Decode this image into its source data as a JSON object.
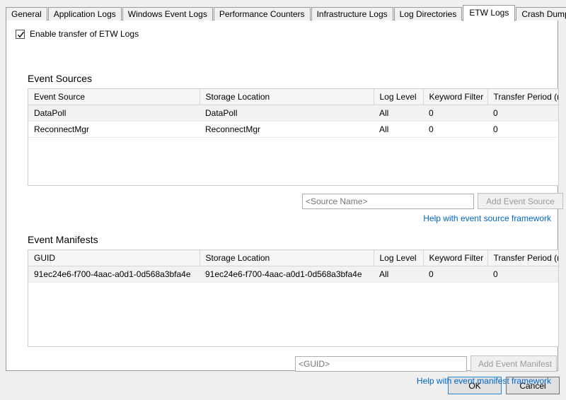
{
  "tabs": [
    {
      "label": "General",
      "selected": false
    },
    {
      "label": "Application Logs",
      "selected": false
    },
    {
      "label": "Windows Event Logs",
      "selected": false
    },
    {
      "label": "Performance Counters",
      "selected": false
    },
    {
      "label": "Infrastructure Logs",
      "selected": false
    },
    {
      "label": "Log Directories",
      "selected": false
    },
    {
      "label": "ETW Logs",
      "selected": true
    },
    {
      "label": "Crash Dumps",
      "selected": false
    }
  ],
  "enable_checkbox": {
    "label": "Enable transfer of ETW Logs",
    "checked": true,
    "icon": "checkmark-icon"
  },
  "event_sources": {
    "title": "Event Sources",
    "columns": [
      "Event Source",
      "Storage Location",
      "Log Level",
      "Keyword Filter",
      "Transfer Period (min)"
    ],
    "rows": [
      {
        "name": "DataPoll",
        "location": "DataPoll",
        "level": "All",
        "keyword": "0",
        "period": "0"
      },
      {
        "name": "ReconnectMgr",
        "location": "ReconnectMgr",
        "level": "All",
        "keyword": "0",
        "period": "0"
      }
    ],
    "input_placeholder": "<Source Name>",
    "input_value": "",
    "add_button": "Add Event Source",
    "help_link": "Help with event source framework"
  },
  "event_manifests": {
    "title": "Event Manifests",
    "columns": [
      "GUID",
      "Storage Location",
      "Log Level",
      "Keyword Filter",
      "Transfer Period (min)"
    ],
    "rows": [
      {
        "name": "91ec24e6-f700-4aac-a0d1-0d568a3bfa4e",
        "location": "91ec24e6-f700-4aac-a0d1-0d568a3bfa4e",
        "level": "All",
        "keyword": "0",
        "period": "0"
      }
    ],
    "input_placeholder": "<GUID>",
    "input_value": "",
    "add_button": "Add Event Manifest",
    "help_link": "Help with event manifest framework"
  },
  "footer": {
    "ok_label": "OK",
    "cancel_label": "Cancel"
  },
  "colors": {
    "link": "#0066cc",
    "panel_bg": "#ffffff",
    "dialog_bg": "#f0f0f0",
    "grid_header_bg": "#f5f5f5",
    "row_alt_bg": "#f2f2f2",
    "focus_border": "#2a8ad4"
  }
}
